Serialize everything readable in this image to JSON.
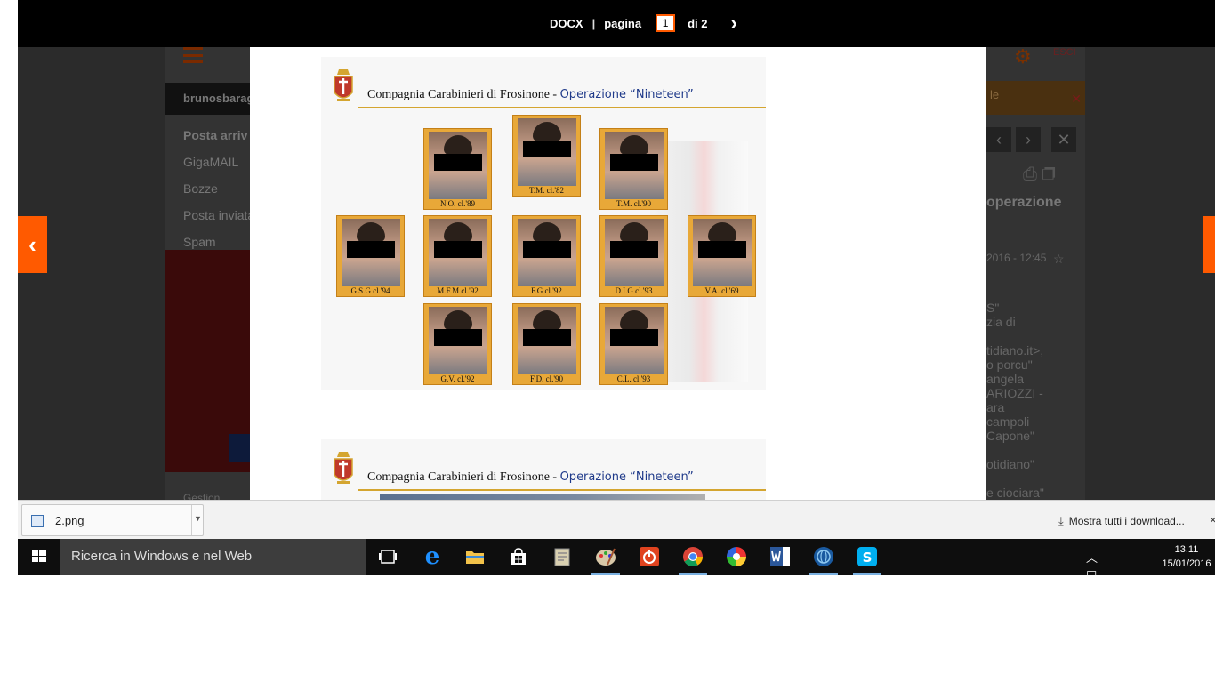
{
  "viewer": {
    "format": "DOCX",
    "separator": "|",
    "page_label": "pagina",
    "page_current": "1",
    "page_total": "di 2",
    "next_glyph": "›",
    "prev_side": "‹",
    "next_side": "‹"
  },
  "slide": {
    "header_text": "Compagnia Carabinieri di Frosinone - ",
    "operation": "Operazione “Nineteen”"
  },
  "photos": [
    {
      "caption": "N.O. cl.'89"
    },
    {
      "caption": "T.M. cl.'82"
    },
    {
      "caption": "T.M. cl.'90"
    },
    {
      "caption": "G.S.G cl.'94"
    },
    {
      "caption": "M.F.M cl.'92"
    },
    {
      "caption": "F.G cl.'92"
    },
    {
      "caption": "D.I.G cl.'93"
    },
    {
      "caption": "V.A. cl.'69"
    },
    {
      "caption": "G.V. cl.'92"
    },
    {
      "caption": "F.D. cl.'90"
    },
    {
      "caption": "C.L. cl.'93"
    }
  ],
  "background_app": {
    "username": "brunosbaragl",
    "folders": [
      "Posta arriv",
      "GigaMAIL",
      "Bozze",
      "Posta inviata",
      "Spam"
    ],
    "bottom_folder": "Gestion",
    "exit_label": "ESCI",
    "notice_text": "le",
    "message_title": "operazione",
    "message_date": "2016 - 12:45",
    "message_lines": [
      "S\"",
      "zia di",
      "",
      "tidiano.it>,",
      "o porcu\"",
      "angela",
      "ARIOZZI -",
      "ara",
      "campoli",
      "Capone\"",
      "",
      "otidiano\"",
      "",
      "e ciociara\""
    ]
  },
  "download_bar": {
    "file_name": "2.png",
    "show_all": "Mostra tutti i download...",
    "close_glyph": "×"
  },
  "taskbar": {
    "search_placeholder": "Ricerca in Windows e nel Web",
    "time": "13.11",
    "date": "15/01/2016",
    "tray_arrows": "^",
    "apps": [
      "task-view",
      "edge",
      "file-explorer",
      "store",
      "notepad",
      "paint",
      "power",
      "chrome",
      "picasa",
      "word",
      "browser-globe",
      "skype"
    ]
  },
  "colors": {
    "accent_orange": "#ff5a00",
    "frame_gold": "#e8a838",
    "operation_blue": "#1f3a8a"
  }
}
